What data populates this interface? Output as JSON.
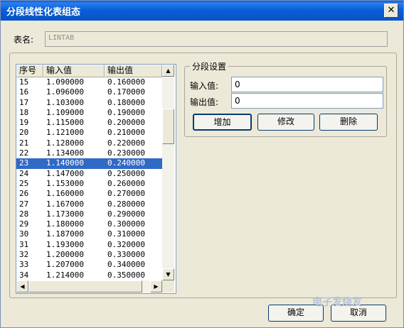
{
  "window": {
    "title": "分段线性化表组态",
    "close_icon": "✕"
  },
  "table_name": {
    "label": "表名:",
    "value": "LINTAB"
  },
  "list": {
    "columns": [
      "序号",
      "输入值",
      "输出值"
    ],
    "rows": [
      [
        "15",
        "1.090000",
        "0.160000"
      ],
      [
        "16",
        "1.096000",
        "0.170000"
      ],
      [
        "17",
        "1.103000",
        "0.180000"
      ],
      [
        "18",
        "1.109000",
        "0.190000"
      ],
      [
        "19",
        "1.115000",
        "0.200000"
      ],
      [
        "20",
        "1.121000",
        "0.210000"
      ],
      [
        "21",
        "1.128000",
        "0.220000"
      ],
      [
        "22",
        "1.134000",
        "0.230000"
      ],
      [
        "23",
        "1.140000",
        "0.240000"
      ],
      [
        "24",
        "1.147000",
        "0.250000"
      ],
      [
        "25",
        "1.153000",
        "0.260000"
      ],
      [
        "26",
        "1.160000",
        "0.270000"
      ],
      [
        "27",
        "1.167000",
        "0.280000"
      ],
      [
        "28",
        "1.173000",
        "0.290000"
      ],
      [
        "29",
        "1.180000",
        "0.300000"
      ],
      [
        "30",
        "1.187000",
        "0.310000"
      ],
      [
        "31",
        "1.193000",
        "0.320000"
      ],
      [
        "32",
        "1.200000",
        "0.330000"
      ],
      [
        "33",
        "1.207000",
        "0.340000"
      ],
      [
        "34",
        "1.214000",
        "0.350000"
      ]
    ],
    "selected_row": "23"
  },
  "segment": {
    "legend": "分段设置",
    "input_label": "输入值:",
    "input_value": "0",
    "output_label": "输出值:",
    "output_value": "0",
    "add_label": "增加",
    "modify_label": "修改",
    "delete_label": "删除"
  },
  "footer": {
    "ok_label": "确定",
    "cancel_label": "取消",
    "watermark": "电子发烧友"
  },
  "icons": {
    "scroll_up": "▲",
    "scroll_down": "▼",
    "scroll_left": "◀",
    "scroll_right": "▶"
  },
  "colors": {
    "title_bar": "#0a5fd8",
    "selection": "#316ac5",
    "dialog_bg": "#ece9d8"
  }
}
